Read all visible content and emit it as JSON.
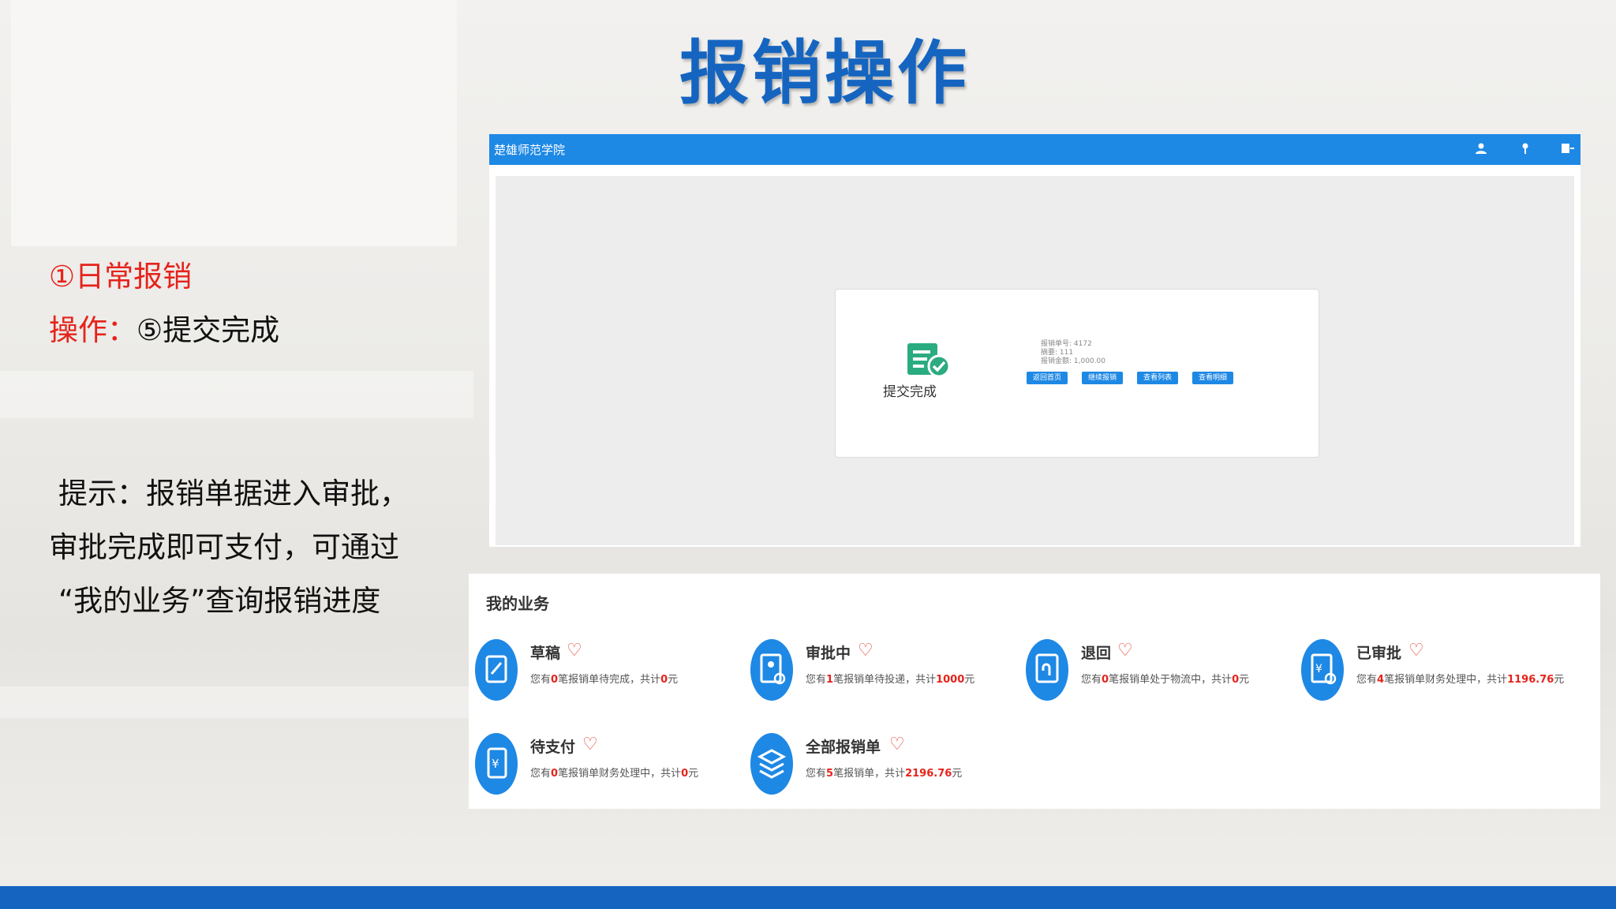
{
  "slide": {
    "title": "报销操作",
    "heading1": "①日常报销",
    "op_prefix": "操作：",
    "op_step": "⑤提交完成",
    "tip_lines": [
      "提示：报销单据进入审批，",
      "审批完成即可支付，可通过",
      "“我的业务”查询报销进度"
    ]
  },
  "app": {
    "title": "楚雄师范学院",
    "header_icons": [
      "user-icon",
      "location-pin-icon",
      "logout-icon"
    ],
    "done_label": "提交完成",
    "info": {
      "number": "报销单号: 4172",
      "summary": "摘要: 111",
      "amount": "报销金额: 1,000.00"
    },
    "buttons": [
      "返回首页",
      "继续报销",
      "查看列表",
      "查看明细"
    ]
  },
  "my_business": {
    "title": "我的业务",
    "items": [
      {
        "name": "草稿",
        "icon": "draft-icon",
        "pre": "您有",
        "count": "0",
        "mid": "笔报销单待完成，共计",
        "total": "0",
        "unit": "元"
      },
      {
        "name": "审批中",
        "icon": "approving-icon",
        "pre": "您有",
        "count": "1",
        "mid": "笔报销单待投递，共计",
        "total": "1000",
        "unit": "元"
      },
      {
        "name": "退回",
        "icon": "returned-icon",
        "pre": "您有",
        "count": "0",
        "mid": "笔报销单处于物流中，共计",
        "total": "0",
        "unit": "元"
      },
      {
        "name": "已审批",
        "icon": "approved-icon",
        "pre": "您有",
        "count": "4",
        "mid": "笔报销单财务处理中，共计",
        "total": "1196.76",
        "unit": "元"
      },
      {
        "name": "待支付",
        "icon": "pending-payment-icon",
        "pre": "您有",
        "count": "0",
        "mid": "笔报销单财务处理中，共计",
        "total": "0",
        "unit": "元"
      },
      {
        "name": "全部报销单",
        "icon": "all-reimbursements-icon",
        "pre": "您有",
        "count": "5",
        "mid": "笔报销单，共计",
        "total": "2196.76",
        "unit": "元"
      }
    ]
  },
  "colors": {
    "brand_blue": "#1e88e5",
    "title_blue": "#1565c0",
    "accent_red": "#e5231b"
  }
}
